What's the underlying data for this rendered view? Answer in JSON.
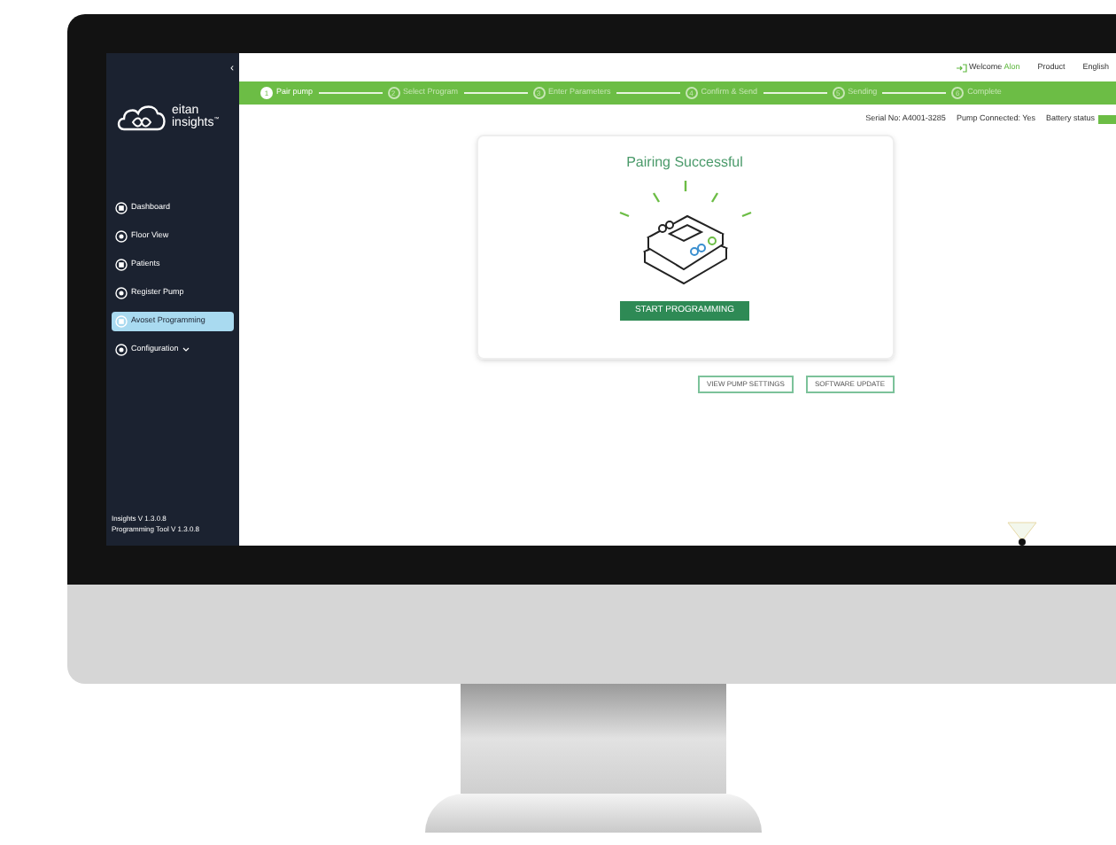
{
  "sidebar": {
    "collapse_icon": "‹",
    "logo": {
      "name": "eitan",
      "subtitle": "insights",
      "mark": "™"
    },
    "items": [
      {
        "label": "Dashboard",
        "selected": false,
        "kind": "plain"
      },
      {
        "label": "Floor View",
        "selected": false,
        "kind": "plain"
      },
      {
        "label": "Patients",
        "selected": false,
        "kind": "plain"
      },
      {
        "label": "Register Pump",
        "selected": false,
        "kind": "plain"
      },
      {
        "label": "Avoset Programming",
        "selected": true,
        "kind": "plain"
      },
      {
        "label": "Configuration",
        "selected": false,
        "kind": "dropdown"
      }
    ],
    "versions": [
      "Insights V 1.3.0.8",
      "Programming Tool V 1.3.0.8"
    ]
  },
  "header": {
    "welcome": "Welcome",
    "user": "Alon",
    "links": [
      "Product",
      "English"
    ]
  },
  "steps": [
    {
      "number": "1",
      "label": "Pair pump",
      "selected": true
    },
    {
      "number": "2",
      "label": "Select Program",
      "selected": false
    },
    {
      "number": "3",
      "label": "Enter Parameters",
      "selected": false
    },
    {
      "number": "4",
      "label": "Confirm & Send",
      "selected": false
    },
    {
      "number": "5",
      "label": "Sending",
      "selected": false
    },
    {
      "number": "6",
      "label": "Complete",
      "selected": false
    }
  ],
  "status": {
    "serial": "Serial No: A4001-3285",
    "connected": "Pump Connected: Yes",
    "battery": "Battery status"
  },
  "card": {
    "title": "Pairing Successful",
    "button": "START PROGRAMMING"
  },
  "actions": [
    "VIEW PUMP SETTINGS",
    "SOFTWARE UPDATE"
  ]
}
